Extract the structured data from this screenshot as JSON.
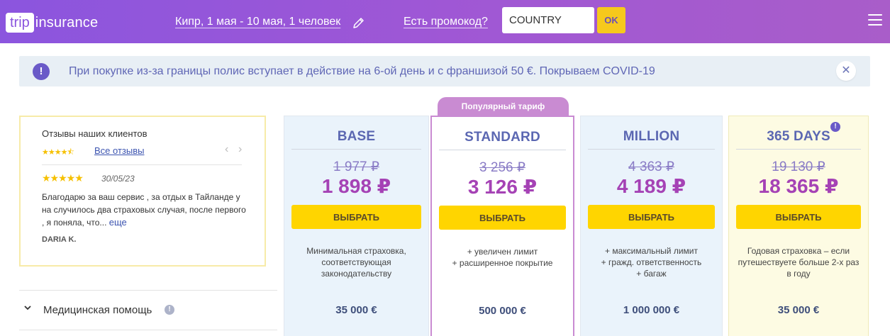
{
  "header": {
    "logo_box": "trip",
    "logo_rest": "insurance",
    "trip_summary": "Кипр, 1 мая - 10 мая, 1 человек",
    "promo_question": "Есть промокод?",
    "promo_value": "COUNTRY",
    "ok_label": "OK"
  },
  "notice": {
    "icon_glyph": "!",
    "text": "При покупке из-за границы полис вступает в действие на 6-ой день и с франшизой 50 €. Покрываем COVID-19",
    "close_glyph": "✕"
  },
  "reviews": {
    "title": "Отзывы наших клиентов",
    "rating_stars": "★★★★⯪",
    "all_reviews": "Все отзывы",
    "prev": "‹",
    "next": "›",
    "review_stars": "★★★★★",
    "review_date": "30/05/23",
    "review_text": "Благодарю за ваш сервис , за отдых в Тайланде у на случилось два страховых случая, после первого , я поняла, что...",
    "more": "еще",
    "author": "DARIA K."
  },
  "left_list": {
    "medical_label": "Медицинская помощь",
    "info_glyph": "!"
  },
  "popular_badge": "Популярный тариф",
  "plans": [
    {
      "name": "BASE",
      "old_price": "1 977 ₽",
      "new_price": "1 898 ₽",
      "button": "ВЫБРАТЬ",
      "description": "Минимальная страховка, соответствующая законодательству",
      "limit": "35 000 €"
    },
    {
      "name": "STANDARD",
      "old_price": "3 256 ₽",
      "new_price": "3 126 ₽",
      "button": "ВЫБРАТЬ",
      "description": "+ увеличен лимит\n+ расширенное покрытие",
      "limit": "500 000 €"
    },
    {
      "name": "MILLION",
      "old_price": "4 363 ₽",
      "new_price": "4 189 ₽",
      "button": "ВЫБРАТЬ",
      "description": "+ максимальный лимит\n+ гражд. ответственность\n+ багаж",
      "limit": "1 000 000 €"
    },
    {
      "name": "365 DAYS",
      "old_price": "19 130 ₽",
      "new_price": "18 365 ₽",
      "button": "ВЫБРАТЬ",
      "description": "Годовая страховка – если путешествуете больше 2-х раз в году",
      "limit": "35 000 €",
      "info_glyph": "!"
    }
  ],
  "colors": {
    "header_gradient_start": "#8b55de",
    "header_gradient_end": "#a95dc9",
    "price": "#a542b5",
    "plan_name": "#5b67b2",
    "button": "#ffd500",
    "popular": "#c98bd2"
  },
  "icons": {
    "edit": "pencil-icon",
    "menu": "hamburger-menu-icon",
    "notice": "info-icon",
    "close": "close-icon",
    "expand": "chevron-down-icon"
  }
}
